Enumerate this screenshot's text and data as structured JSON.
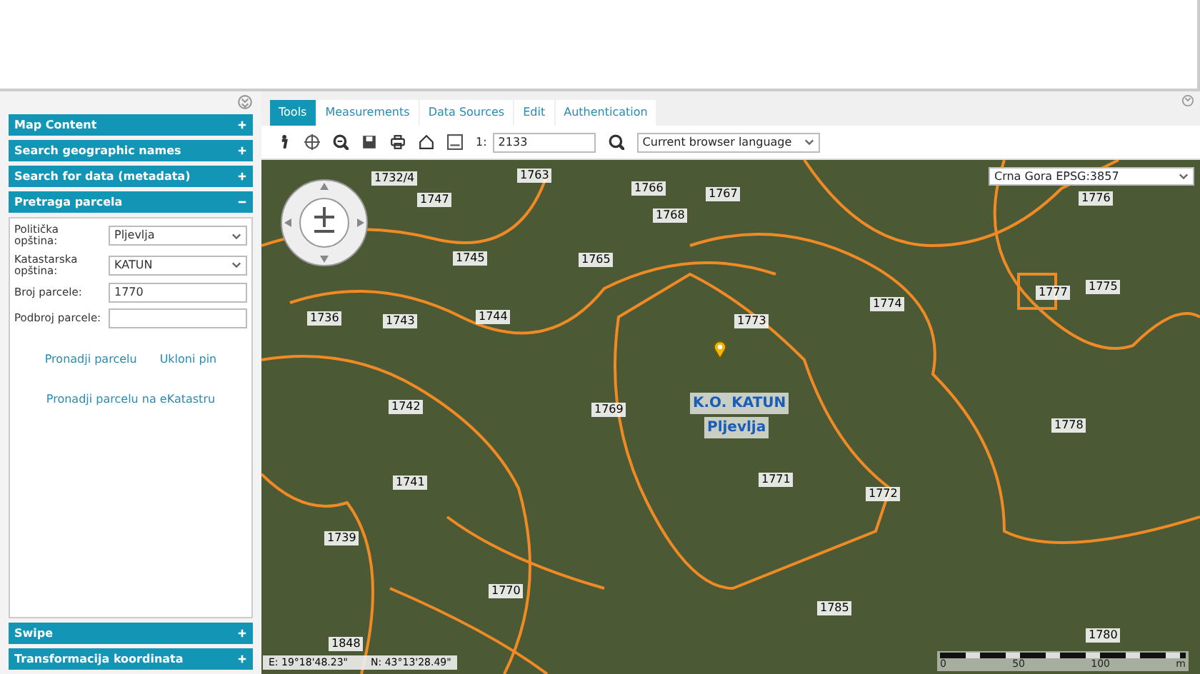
{
  "sidebar": {
    "panels_top": [
      {
        "title": "Map Content",
        "expanded": false
      },
      {
        "title": "Search geographic names",
        "expanded": false
      },
      {
        "title": "Search for data (metadata)",
        "expanded": false
      },
      {
        "title": "Pretraga parcela",
        "expanded": true
      }
    ],
    "form": {
      "fields": [
        {
          "kind": "select",
          "label": "Politička opština:",
          "value": "Pljevlja"
        },
        {
          "kind": "select",
          "label": "Katastarska opština:",
          "value": "KATUN"
        },
        {
          "kind": "input",
          "label": "Broj parcele:",
          "value": "1770"
        },
        {
          "kind": "input",
          "label": "Podbroj parcele:"
        }
      ],
      "links": [
        "Pronadji parcelu",
        "Ukloni pin"
      ],
      "link_bottom": "Pronadji parcelu na eKatastru"
    },
    "panels_bottom": [
      {
        "title": "Swipe",
        "expanded": false
      },
      {
        "title": "Transformacija koordinata",
        "expanded": false
      }
    ]
  },
  "tabs": [
    {
      "label": "Tools",
      "selected": true
    },
    {
      "label": "Measurements",
      "selected": false
    },
    {
      "label": "Data Sources",
      "selected": false
    },
    {
      "label": "Edit",
      "selected": false
    },
    {
      "label": "Authentication",
      "selected": false
    }
  ],
  "toolbar": {
    "scale_prefix": "1:",
    "scale": "2133",
    "language": "Current browser language"
  },
  "map": {
    "projection": "Crna Gora EPSG:3857",
    "parcels": [
      "1732/4",
      "1747",
      "1763",
      "1766",
      "1767",
      "1765",
      "1768",
      "1745",
      "1773",
      "1774",
      "1736",
      "1743",
      "1744",
      "1777",
      "1775",
      "1776",
      "1742",
      "1769",
      "1778",
      "1741",
      "1771",
      "1772",
      "1739",
      "1770",
      "1785",
      "1780",
      "1848"
    ],
    "place_labels": [
      "K.O. KATUN",
      "Pljevlja"
    ],
    "coordinates": {
      "east": "E: 19°18'48.23\"",
      "north": "N: 43°13'28.49\""
    },
    "scale_bar": [
      "0",
      "50",
      "100",
      "m"
    ]
  }
}
